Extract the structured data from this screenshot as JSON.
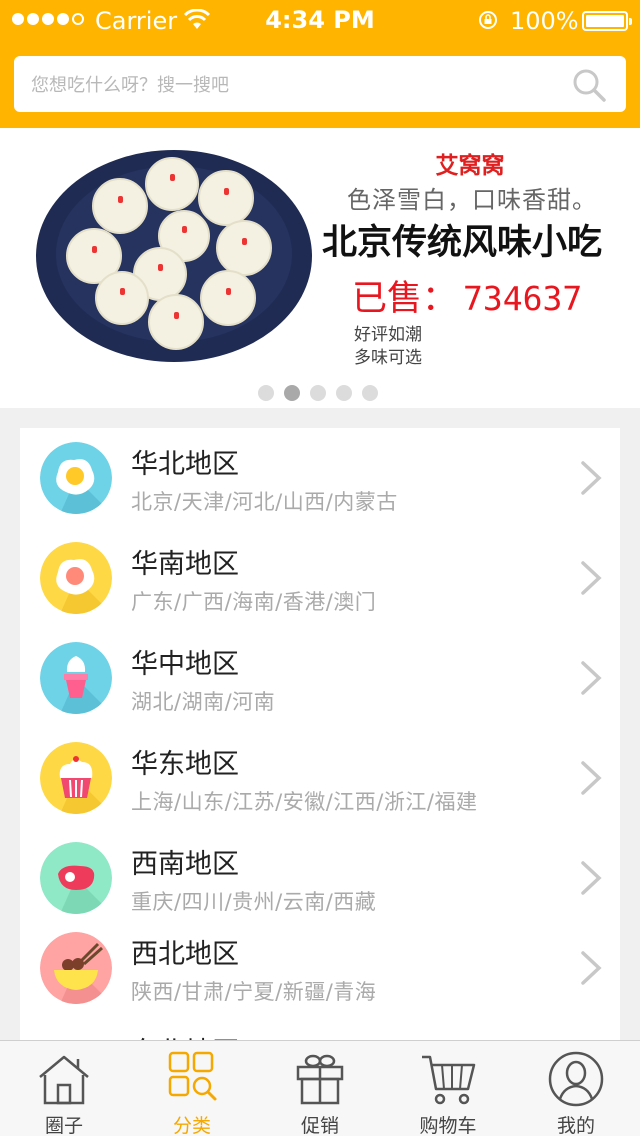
{
  "status_bar": {
    "carrier": "Carrier",
    "time": "4:34 PM",
    "battery": "100%"
  },
  "search": {
    "placeholder": "您想吃什么呀？搜一搜吧"
  },
  "banner": {
    "brand": "艾窝窝",
    "tagline": "色泽雪白，口味香甜。",
    "headline": "北京传统风味小吃",
    "sold_label": "已售：",
    "sold_count": "734637",
    "note_1": "好评如潮",
    "note_2": "多味可选",
    "slide_count": 5,
    "active_slide": 2
  },
  "regions": [
    {
      "title": "华北地区",
      "subtitle": "北京/天津/河北/山西/内蒙古",
      "icon": "fried-egg-icon",
      "color": "#6fd3e8"
    },
    {
      "title": "华南地区",
      "subtitle": "广东/广西/海南/香港/澳门",
      "icon": "fried-egg-icon",
      "color": "#ffd845"
    },
    {
      "title": "华中地区",
      "subtitle": "湖北/湖南/河南",
      "icon": "ice-cream-icon",
      "color": "#6fd3e8"
    },
    {
      "title": "华东地区",
      "subtitle": "上海/山东/江苏/安徽/江西/浙江/福建",
      "icon": "cupcake-icon",
      "color": "#ffd845"
    },
    {
      "title": "西南地区",
      "subtitle": "重庆/四川/贵州/云南/西藏",
      "icon": "steak-icon",
      "color": "#8fe8c6"
    },
    {
      "title": "西北地区",
      "subtitle": "陕西/甘肃/宁夏/新疆/青海",
      "icon": "noodle-bowl-icon",
      "color": "#ffa3a3"
    },
    {
      "title": "东北地区",
      "subtitle": "",
      "icon": "food-icon",
      "color": "#ffd845"
    }
  ],
  "tabs": [
    {
      "label": "圈子",
      "icon": "house-icon",
      "active": false
    },
    {
      "label": "分类",
      "icon": "category-icon",
      "active": true
    },
    {
      "label": "促销",
      "icon": "gift-icon",
      "active": false
    },
    {
      "label": "购物车",
      "icon": "cart-icon",
      "active": false
    },
    {
      "label": "我的",
      "icon": "user-icon",
      "active": false
    }
  ],
  "colors": {
    "accent": "#ffb400",
    "active_tab": "#f5a800",
    "sold_red": "#e8161e"
  }
}
